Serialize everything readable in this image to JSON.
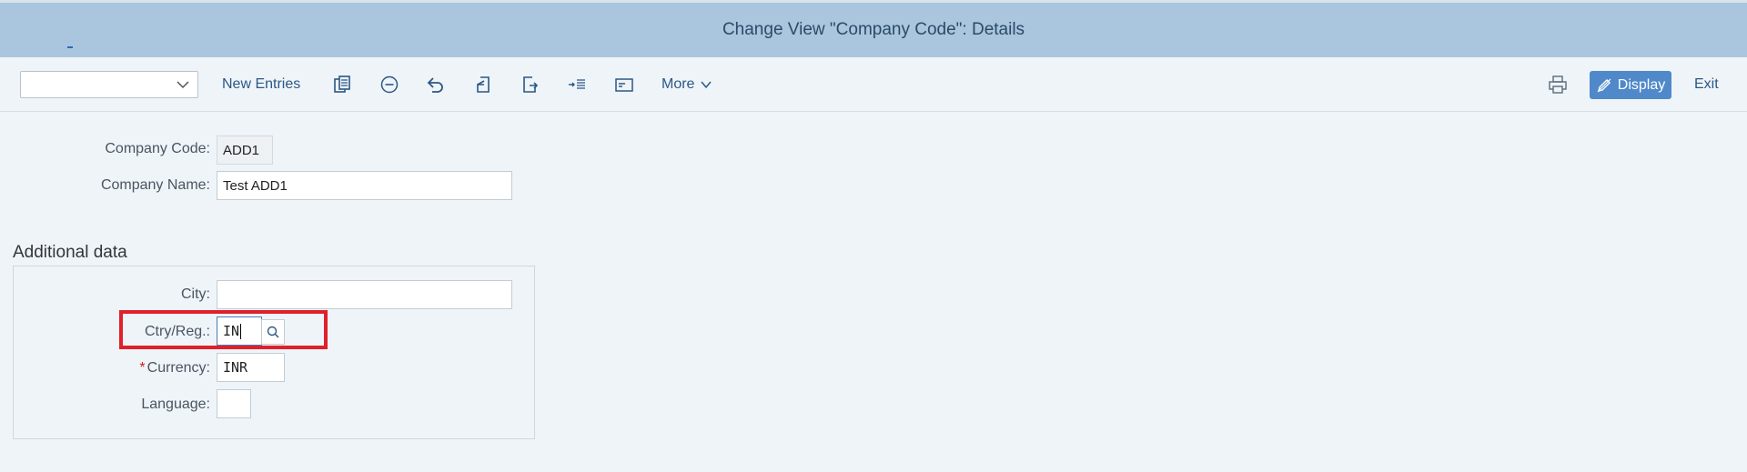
{
  "window": {
    "title": "Change View \"Company Code\": Details"
  },
  "toolbar": {
    "selector_value": "",
    "new_entries_label": "New Entries",
    "more_label": "More",
    "display_label": "Display",
    "exit_label": "Exit",
    "icons": [
      "copy-icon",
      "delete-icon",
      "undo-icon",
      "previous-entry-icon",
      "next-entry-icon",
      "indent-icon",
      "screen-icon",
      "print-icon",
      "display-edit-icon"
    ]
  },
  "header_fields": {
    "company_code_label": "Company Code:",
    "company_code_value": "ADD1",
    "company_name_label": "Company Name:",
    "company_name_value": "Test ADD1"
  },
  "additional_data": {
    "section_title": "Additional data",
    "city_label": "City:",
    "city_value": "",
    "country_label": "Ctry/Reg.:",
    "country_value": "IN",
    "currency_required_marker": "*",
    "currency_label": "Currency:",
    "currency_value": "INR",
    "language_label": "Language:",
    "language_value": ""
  },
  "colors": {
    "title_bar": "#a9c6de",
    "background": "#eff4f9",
    "accent_button": "#5089c9",
    "highlight_box": "#e0202a",
    "toolbar_text": "#2a5885"
  }
}
